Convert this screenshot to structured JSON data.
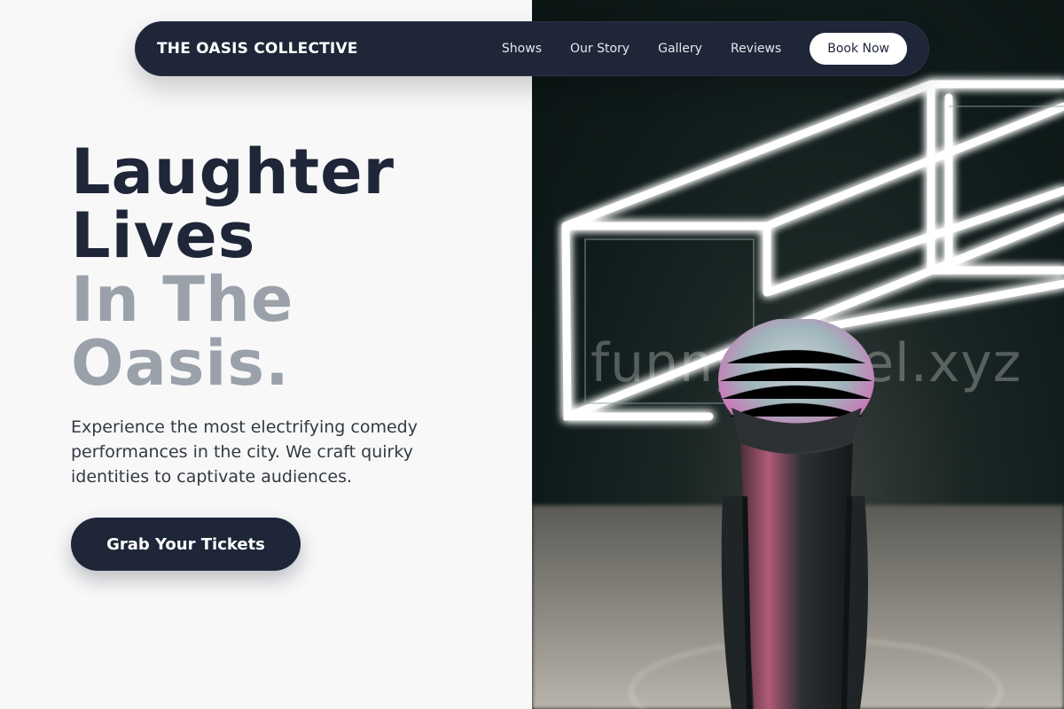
{
  "nav": {
    "brand": "THE OASIS COLLECTIVE",
    "links": [
      "Shows",
      "Our Story",
      "Gallery",
      "Reviews"
    ],
    "cta_label": "Book Now"
  },
  "hero": {
    "headline_lines": [
      "Laughter",
      "Lives",
      "In The",
      "Oasis."
    ],
    "description": "Experience the most electrifying comedy performances in the city. We craft quirky identities to captivate audiences.",
    "cta_label": "Grab Your Tickets"
  },
  "image": {
    "watermark": "funnysomel.xyz",
    "subject": "microphone-on-stage-with-neon-lights"
  },
  "colors": {
    "navy": "#1e2638",
    "grey_text": "#9ba1ab",
    "background": "#f8f8f8"
  }
}
